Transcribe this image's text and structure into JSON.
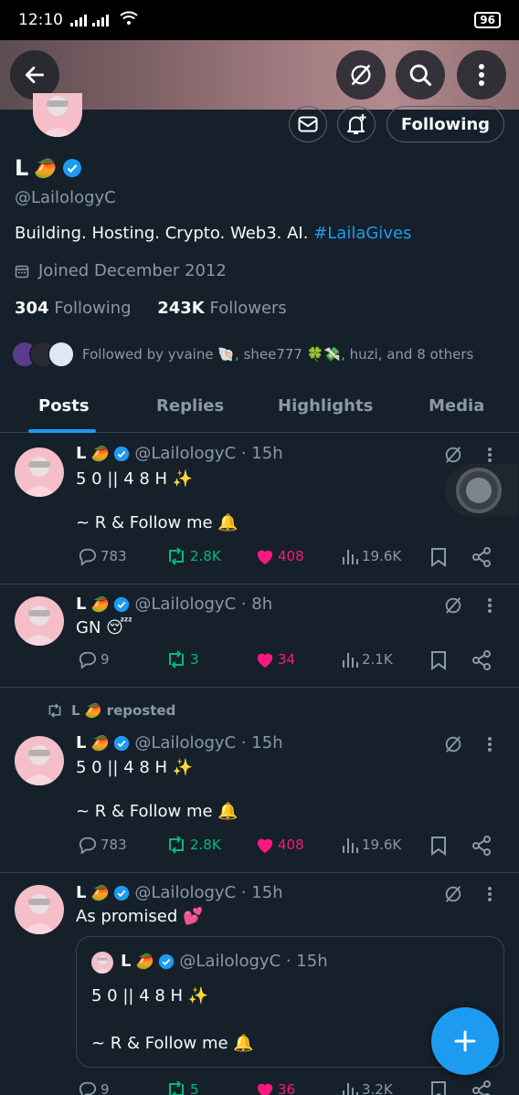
{
  "status": {
    "time": "12:10",
    "battery": "96"
  },
  "profile": {
    "name": "L",
    "name_emoji": "🥭",
    "handle": "@LailologyC",
    "bio_text": "Building. Hosting. Crypto. Web3. AI. ",
    "bio_tag": "#LailaGives",
    "joined": "Joined December 2012",
    "following_count": "304",
    "following_label": "Following",
    "followers_count": "243K",
    "followers_label": "Followers",
    "followed_by": "Followed by yvaine 🐚, shee777 🍀💸, huzi, and 8 others",
    "follow_button": "Following"
  },
  "tabs": [
    "Posts",
    "Replies",
    "Highlights",
    "Media"
  ],
  "repost_label": "L 🥭 reposted",
  "posts": [
    {
      "name": "L",
      "emoji": "🥭",
      "meta": "@LailologyC · 15h",
      "text": "5 0 || 4 8 H ✨\n\n~ R & Follow me 🔔",
      "replies": "783",
      "reposts": "2.8K",
      "likes": "408",
      "views": "19.6K"
    },
    {
      "name": "L",
      "emoji": "🥭",
      "meta": "@LailologyC · 8h",
      "text": "GN 😴",
      "replies": "9",
      "reposts": "3",
      "likes": "34",
      "views": "2.1K"
    },
    {
      "name": "L",
      "emoji": "🥭",
      "meta": "@LailologyC · 15h",
      "text": "5 0 || 4 8 H ✨\n\n~ R & Follow me 🔔",
      "replies": "783",
      "reposts": "2.8K",
      "likes": "408",
      "views": "19.6K"
    },
    {
      "name": "L",
      "emoji": "🥭",
      "meta": "@LailologyC · 15h",
      "text": "As promised 💕",
      "replies": "9",
      "reposts": "5",
      "likes": "36",
      "views": "3.2K",
      "quote": {
        "name": "L",
        "emoji": "🥭",
        "meta": "@LailologyC · 15h",
        "text": "5 0 || 4 8 H ✨\n\n~ R & Follow me 🔔"
      }
    }
  ],
  "colors": {
    "accent": "#1d9bf0",
    "background": "#15202b",
    "like": "#f91880",
    "repost": "#00ba7c"
  },
  "icons": [
    "back-arrow-icon",
    "grok-icon",
    "search-icon",
    "more-icon",
    "mail-icon",
    "bell-plus-icon",
    "verified-icon",
    "calendar-icon",
    "reply-icon",
    "repost-icon",
    "heart-icon",
    "views-icon",
    "bookmark-icon",
    "share-icon",
    "plus-icon"
  ]
}
